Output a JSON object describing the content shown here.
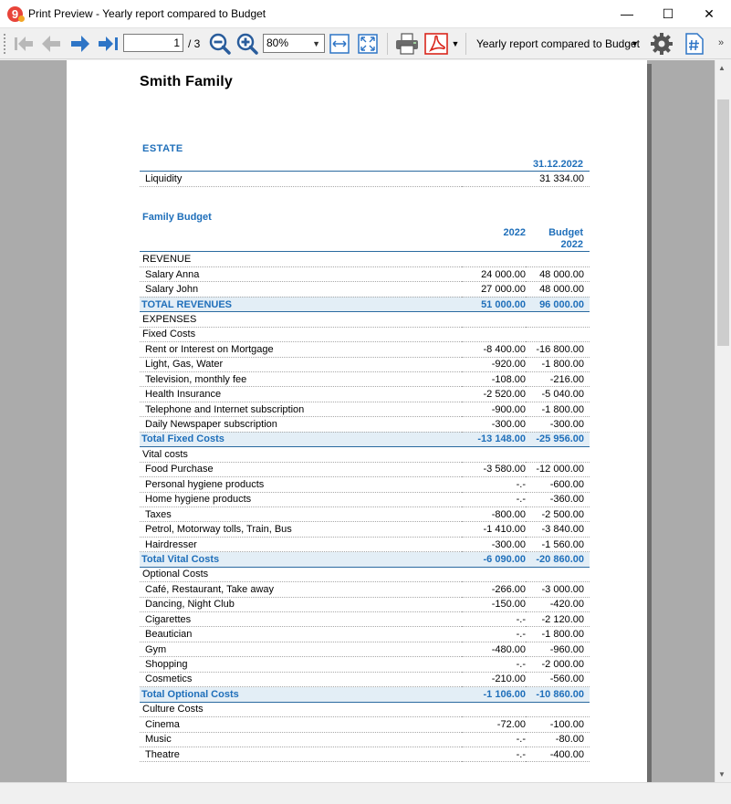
{
  "window": {
    "title": "Print Preview - Yearly report compared to Budget",
    "minimize": "—",
    "maximize": "☐",
    "close": "✕"
  },
  "toolbar": {
    "page_current": "1",
    "page_total": "/ 3",
    "zoom": "80%",
    "report_name": "Yearly report compared to Budget",
    "more": "»"
  },
  "report": {
    "company": "Smith Family",
    "estate": {
      "title": "ESTATE",
      "date_header": "31.12.2022",
      "rows": [
        {
          "label": "Liquidity",
          "value": "31 334.00"
        }
      ]
    },
    "budget": {
      "title": "Family Budget",
      "col1_header": "2022",
      "col2_header_line1": "Budget",
      "col2_header_line2": "2022",
      "rows": [
        {
          "label": "REVENUE",
          "c1": "",
          "c2": "",
          "level": 0,
          "type": "group"
        },
        {
          "label": "Salary Anna",
          "c1": "24 000.00",
          "c2": "48 000.00",
          "level": 1,
          "type": "row"
        },
        {
          "label": "Salary John",
          "c1": "27 000.00",
          "c2": "48 000.00",
          "level": 1,
          "type": "row"
        },
        {
          "label": "TOTAL REVENUES",
          "c1": "51 000.00",
          "c2": "96 000.00",
          "level": 0,
          "type": "total"
        },
        {
          "label": "EXPENSES",
          "c1": "",
          "c2": "",
          "level": 0,
          "type": "group"
        },
        {
          "label": "Fixed Costs",
          "c1": "",
          "c2": "",
          "level": 0,
          "type": "group"
        },
        {
          "label": "Rent or Interest on Mortgage",
          "c1": "-8 400.00",
          "c2": "-16 800.00",
          "level": 1,
          "type": "row"
        },
        {
          "label": "Light, Gas, Water",
          "c1": "-920.00",
          "c2": "-1 800.00",
          "level": 1,
          "type": "row"
        },
        {
          "label": "Television, monthly fee",
          "c1": "-108.00",
          "c2": "-216.00",
          "level": 1,
          "type": "row"
        },
        {
          "label": "Health Insurance",
          "c1": "-2 520.00",
          "c2": "-5 040.00",
          "level": 1,
          "type": "row"
        },
        {
          "label": "Telephone and Internet subscription",
          "c1": "-900.00",
          "c2": "-1 800.00",
          "level": 1,
          "type": "row"
        },
        {
          "label": "Daily Newspaper subscription",
          "c1": "-300.00",
          "c2": "-300.00",
          "level": 1,
          "type": "row"
        },
        {
          "label": "Total Fixed Costs",
          "c1": "-13 148.00",
          "c2": "-25 956.00",
          "level": 0,
          "type": "total"
        },
        {
          "label": "Vital costs",
          "c1": "",
          "c2": "",
          "level": 0,
          "type": "group"
        },
        {
          "label": "Food Purchase",
          "c1": "-3 580.00",
          "c2": "-12 000.00",
          "level": 1,
          "type": "row"
        },
        {
          "label": "Personal hygiene products",
          "c1": "-.-",
          "c2": "-600.00",
          "level": 1,
          "type": "row"
        },
        {
          "label": "Home hygiene products",
          "c1": "-.-",
          "c2": "-360.00",
          "level": 1,
          "type": "row"
        },
        {
          "label": "Taxes",
          "c1": "-800.00",
          "c2": "-2 500.00",
          "level": 1,
          "type": "row"
        },
        {
          "label": "Petrol, Motorway tolls, Train, Bus",
          "c1": "-1 410.00",
          "c2": "-3 840.00",
          "level": 1,
          "type": "row"
        },
        {
          "label": "Hairdresser",
          "c1": "-300.00",
          "c2": "-1 560.00",
          "level": 1,
          "type": "row"
        },
        {
          "label": "Total Vital Costs",
          "c1": "-6 090.00",
          "c2": "-20 860.00",
          "level": 0,
          "type": "total"
        },
        {
          "label": "Optional Costs",
          "c1": "",
          "c2": "",
          "level": 0,
          "type": "group"
        },
        {
          "label": "Café, Restaurant, Take away",
          "c1": "-266.00",
          "c2": "-3 000.00",
          "level": 1,
          "type": "row"
        },
        {
          "label": "Dancing, Night Club",
          "c1": "-150.00",
          "c2": "-420.00",
          "level": 1,
          "type": "row"
        },
        {
          "label": "Cigarettes",
          "c1": "-.-",
          "c2": "-2 120.00",
          "level": 1,
          "type": "row"
        },
        {
          "label": "Beautician",
          "c1": "-.-",
          "c2": "-1 800.00",
          "level": 1,
          "type": "row"
        },
        {
          "label": "Gym",
          "c1": "-480.00",
          "c2": "-960.00",
          "level": 1,
          "type": "row"
        },
        {
          "label": "Shopping",
          "c1": "-.-",
          "c2": "-2 000.00",
          "level": 1,
          "type": "row"
        },
        {
          "label": "Cosmetics",
          "c1": "-210.00",
          "c2": "-560.00",
          "level": 1,
          "type": "row"
        },
        {
          "label": "Total Optional Costs",
          "c1": "-1 106.00",
          "c2": "-10 860.00",
          "level": 0,
          "type": "total"
        },
        {
          "label": "Culture Costs",
          "c1": "",
          "c2": "",
          "level": 0,
          "type": "group"
        },
        {
          "label": "Cinema",
          "c1": "-72.00",
          "c2": "-100.00",
          "level": 1,
          "type": "row"
        },
        {
          "label": "Music",
          "c1": "-.-",
          "c2": "-80.00",
          "level": 1,
          "type": "row"
        },
        {
          "label": "Theatre",
          "c1": "-.-",
          "c2": "-400.00",
          "level": 1,
          "type": "row"
        }
      ]
    }
  },
  "colors": {
    "accent": "#1f6fba",
    "total_bg": "#e3eef6",
    "arrow_blue": "#2e75c6",
    "pdf_red": "#d9261c"
  },
  "icons": {
    "app": "app-logo-icon",
    "nav": [
      "first-page-icon",
      "previous-page-icon",
      "next-page-icon",
      "last-page-icon"
    ],
    "zoom": [
      "zoom-out-icon",
      "zoom-in-icon"
    ],
    "fit": [
      "fit-width-icon",
      "fit-page-icon"
    ],
    "output": [
      "print-icon",
      "pdf-icon"
    ],
    "other": [
      "settings-gear-icon",
      "page-number-icon"
    ]
  }
}
